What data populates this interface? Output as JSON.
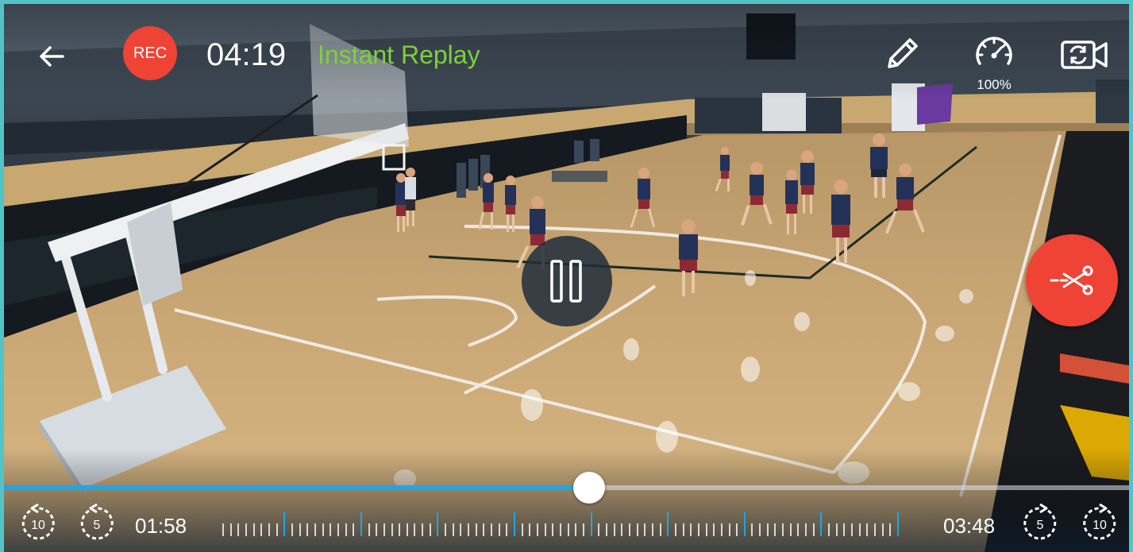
{
  "header": {
    "back_icon": "arrow-left-icon",
    "rec_label": "REC",
    "rec_time": "04:19",
    "mode_label": "Instant Replay",
    "pen_icon": "pencil-icon",
    "speed_icon": "speedometer-icon",
    "speed_label": "100%",
    "camera_icon": "camera-switch-icon"
  },
  "controls": {
    "pause_icon": "pause-icon",
    "clip_icon": "scissors-icon"
  },
  "timeline": {
    "start_time": "01:58",
    "end_time": "03:48",
    "progress": 0.52,
    "rewind_10_label": "10",
    "rewind_5_label": "5",
    "forward_5_label": "5",
    "forward_10_label": "10"
  },
  "colors": {
    "accent": "#1aa8ea",
    "rec_red": "#ef4335",
    "mode_green": "#7dd13a",
    "frame_border": "#52c4c7"
  }
}
